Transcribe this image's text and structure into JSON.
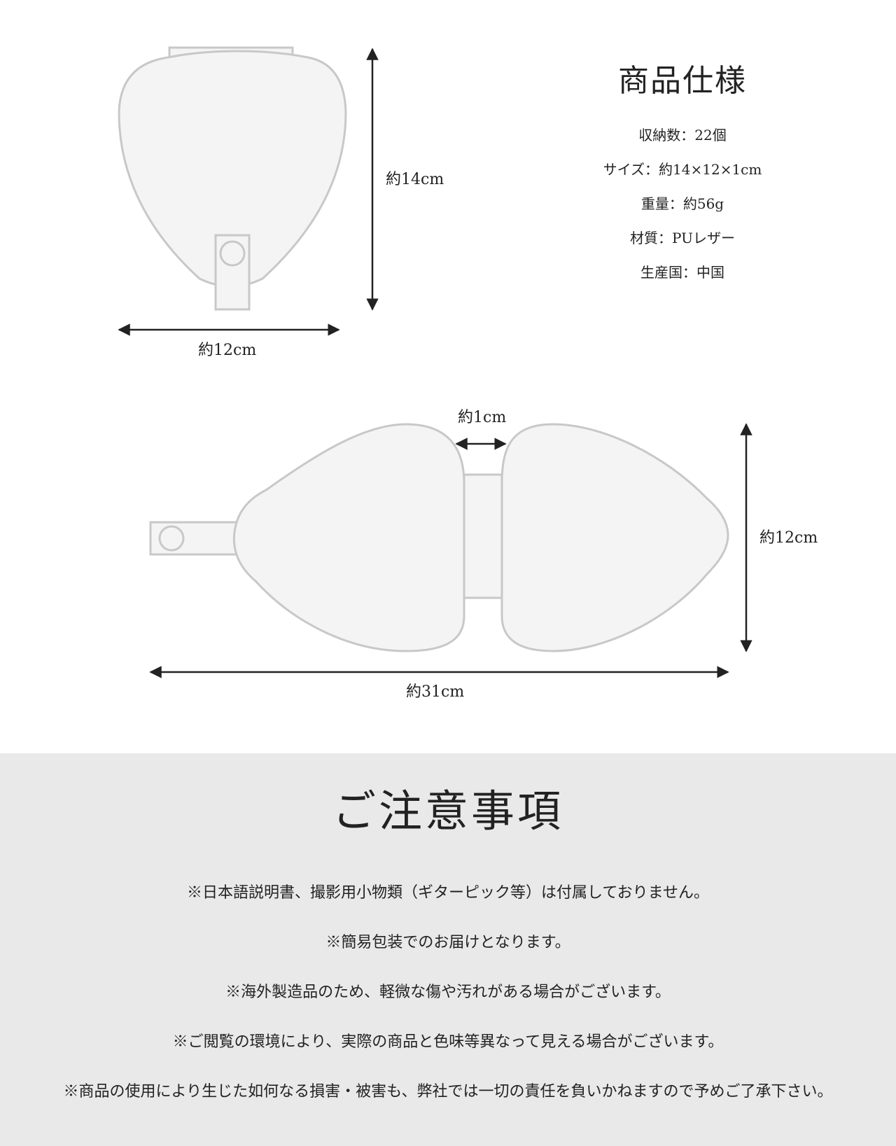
{
  "dimensions": {
    "folded_height": "約14cm",
    "folded_width": "約12cm",
    "open_gap": "約1cm",
    "open_height": "約12cm",
    "open_length": "約31cm"
  },
  "spec": {
    "title": "商品仕様",
    "items": [
      "収納数：22個",
      "サイズ：約14×12×1cm",
      "重量：約56g",
      "材質：PUレザー",
      "生産国：中国"
    ]
  },
  "notes": {
    "title": "ご注意事項",
    "items": [
      "※日本語説明書、撮影用小物類（ギターピック等）は付属しておりません。",
      "※簡易包装でのお届けとなります。",
      "※海外製造品のため、軽微な傷や汚れがある場合がございます。",
      "※ご閲覧の環境により、実際の商品と色味等異なって見える場合がございます。",
      "※商品の使用により生じた如何なる損害・被害も、弊社では一切の責任を負いかねますので予めご了承下さい。"
    ]
  },
  "colors": {
    "outline": "#c8c8c8",
    "fill": "#f4f4f4",
    "arrow": "#222222",
    "notes_bg": "#e9e9e9"
  }
}
